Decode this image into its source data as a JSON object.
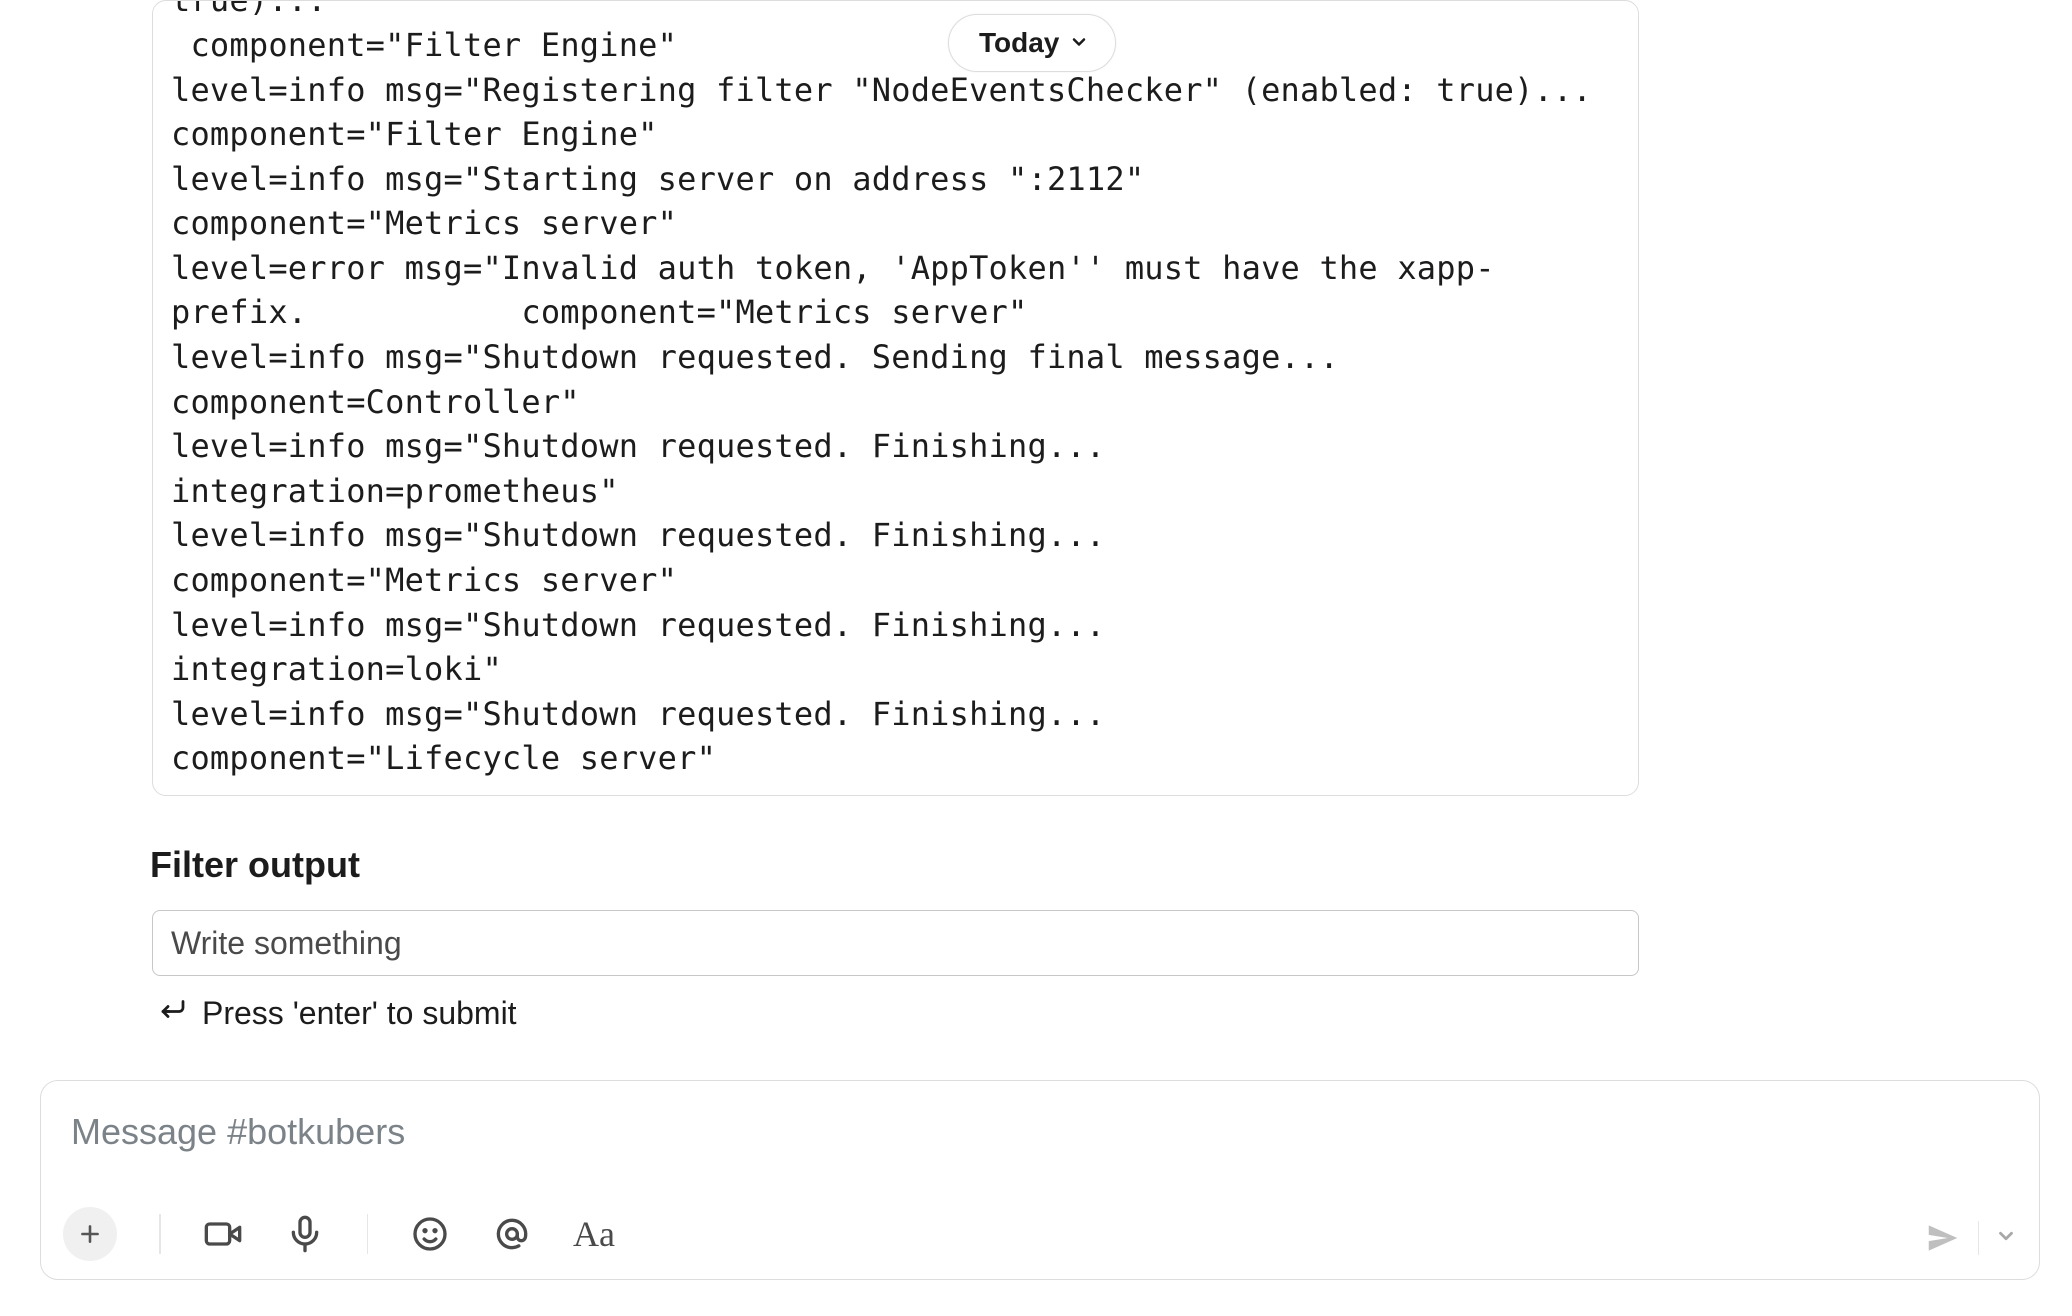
{
  "date_pill": {
    "label": "Today"
  },
  "log_lines": [
    "level=info msg=\"Registering filter \"ObjectAnnotationChecker\" (enabled: true)...",
    " component=\"Filter Engine\"",
    "level=info msg=\"Registering filter \"NodeEventsChecker\" (enabled: true)...            component=\"Filter Engine\"",
    "level=info msg=\"Starting server on address \":2112\"             component=\"Metrics server\"",
    "level=error msg=\"Invalid auth token, 'AppToken'' must have the xapp- prefix.           component=\"Metrics server\"",
    "level=info msg=\"Shutdown requested. Sending final message...              component=Controller\"",
    "level=info msg=\"Shutdown requested. Finishing...               integration=prometheus\"",
    "level=info msg=\"Shutdown requested. Finishing...              component=\"Metrics server\"",
    "level=info msg=\"Shutdown requested. Finishing...              integration=loki\"",
    "level=info msg=\"Shutdown requested. Finishing...               component=\"Lifecycle server\""
  ],
  "filter": {
    "title": "Filter output",
    "placeholder": "Write something",
    "hint": "Press 'enter' to submit"
  },
  "composer": {
    "placeholder": "Message #botkubers"
  }
}
